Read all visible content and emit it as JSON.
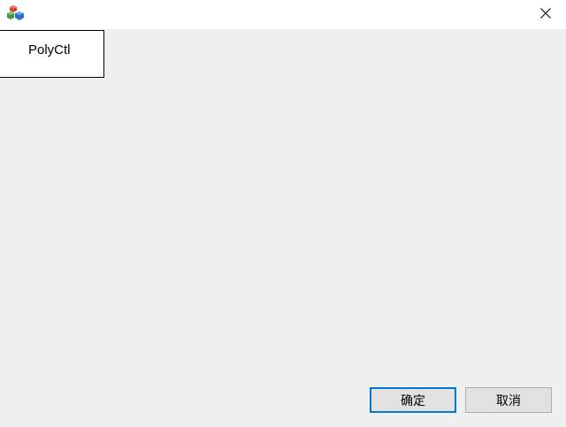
{
  "window": {
    "title": "",
    "icon": "app-cubes-icon",
    "close_icon": "close-icon"
  },
  "control": {
    "label": "PolyCtl"
  },
  "buttons": {
    "ok_label": "确定",
    "cancel_label": "取消"
  },
  "colors": {
    "client_background": "#efefef",
    "default_button_border": "#0078d7",
    "button_face": "#e1e1e1"
  }
}
